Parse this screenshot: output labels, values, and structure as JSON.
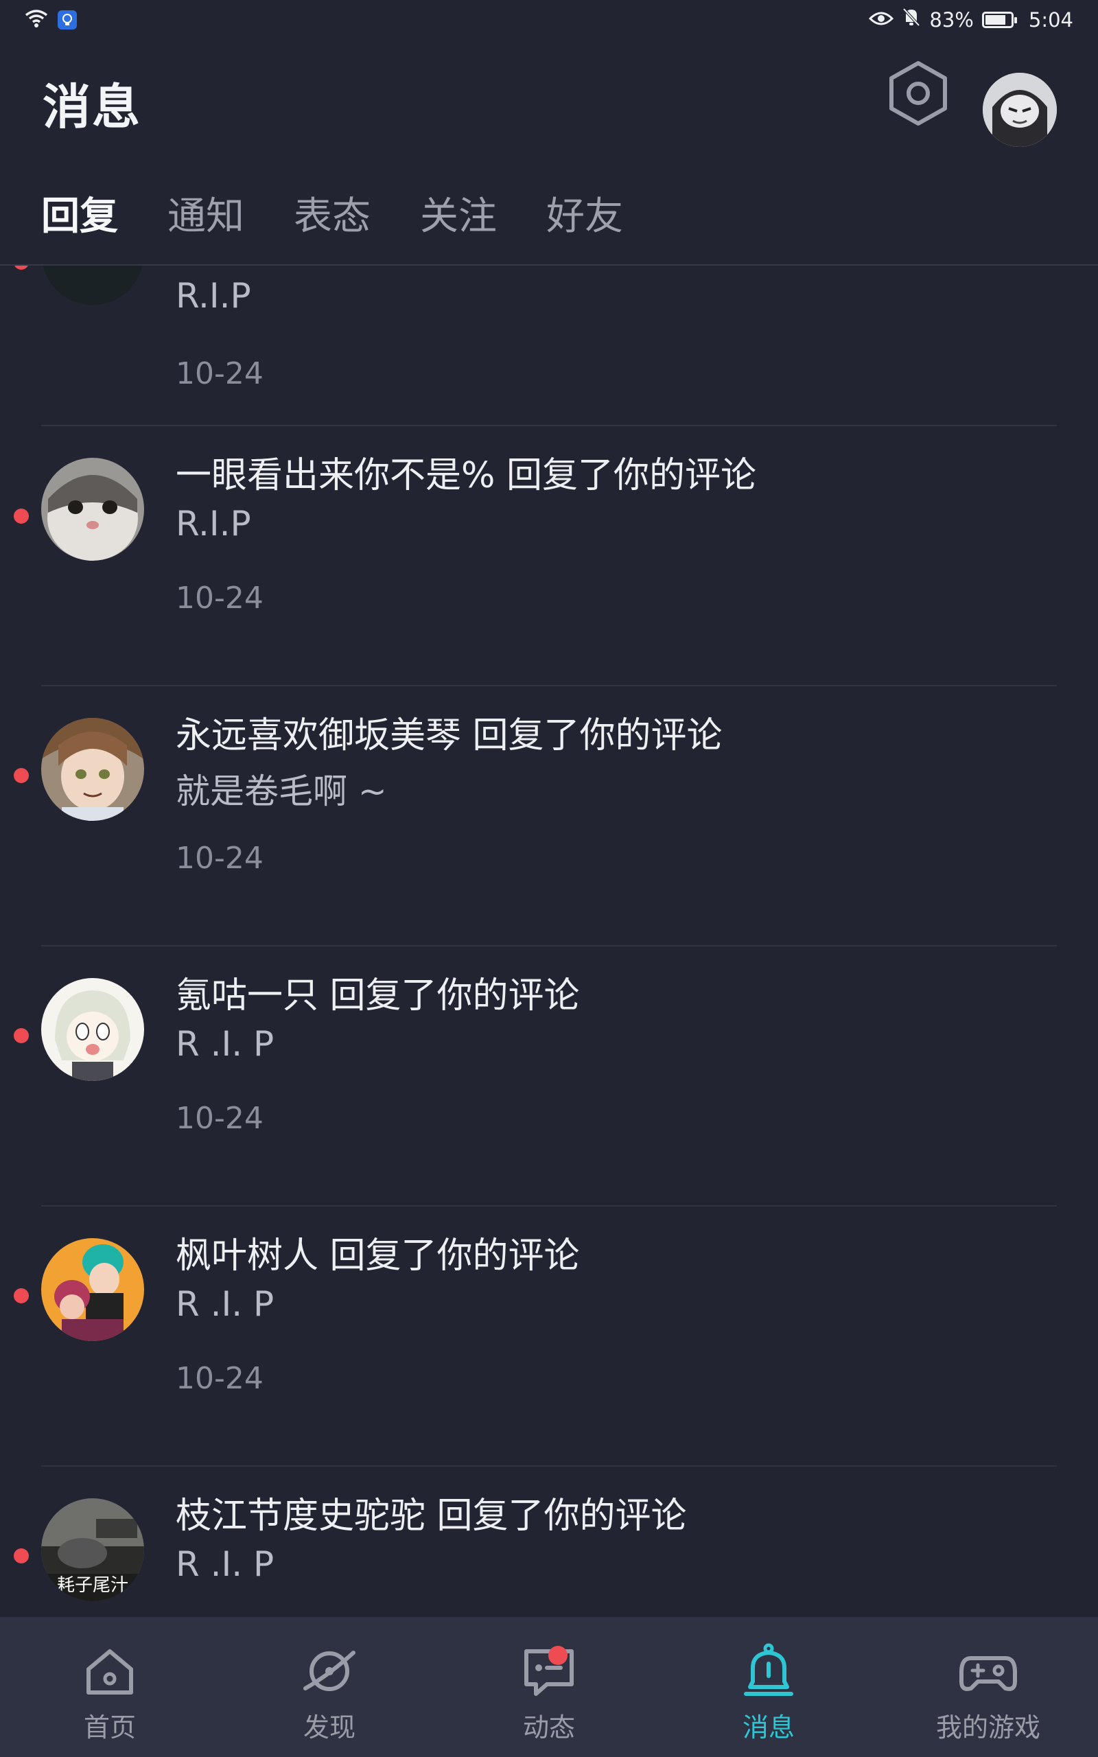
{
  "status_bar": {
    "battery_percent": "83%",
    "battery_level": 0.83,
    "time": "5:04"
  },
  "header": {
    "title": "消息"
  },
  "tabs": [
    {
      "label": "回复",
      "active": true
    },
    {
      "label": "通知",
      "active": false
    },
    {
      "label": "表态",
      "active": false
    },
    {
      "label": "关注",
      "active": false
    },
    {
      "label": "好友",
      "active": false
    }
  ],
  "messages": [
    {
      "title": "",
      "content": "R.I.P",
      "time": "10-24",
      "unread": true
    },
    {
      "title": "一眼看出来你不是% 回复了你的评论",
      "content": "R.I.P",
      "time": "10-24",
      "unread": true
    },
    {
      "title": "永远喜欢御坂美琴 回复了你的评论",
      "content": "就是卷毛啊 ~",
      "time": "10-24",
      "unread": true
    },
    {
      "title": "氪咕一只 回复了你的评论",
      "content": "R .I. P",
      "time": "10-24",
      "unread": true
    },
    {
      "title": "枫叶树人 回复了你的评论",
      "content": "R .I. P",
      "time": "10-24",
      "unread": true
    },
    {
      "title": "枝江节度史驼驼 回复了你的评论",
      "content": "R .I. P",
      "time": "10-24",
      "unread": true,
      "avatar_caption": "耗子尾汁"
    }
  ],
  "bottom_nav": [
    {
      "label": "首页",
      "icon": "home-icon",
      "active": false
    },
    {
      "label": "发现",
      "icon": "planet-icon",
      "active": false
    },
    {
      "label": "动态",
      "icon": "chat-bubble-icon",
      "active": false,
      "has_badge": true
    },
    {
      "label": "消息",
      "icon": "bell-icon",
      "active": true
    },
    {
      "label": "我的游戏",
      "icon": "gamepad-icon",
      "active": false
    }
  ],
  "colors": {
    "background": "#222431",
    "accent": "#2ec6d3",
    "unread_dot": "#ef4b52",
    "nav_background": "#2f3242"
  }
}
